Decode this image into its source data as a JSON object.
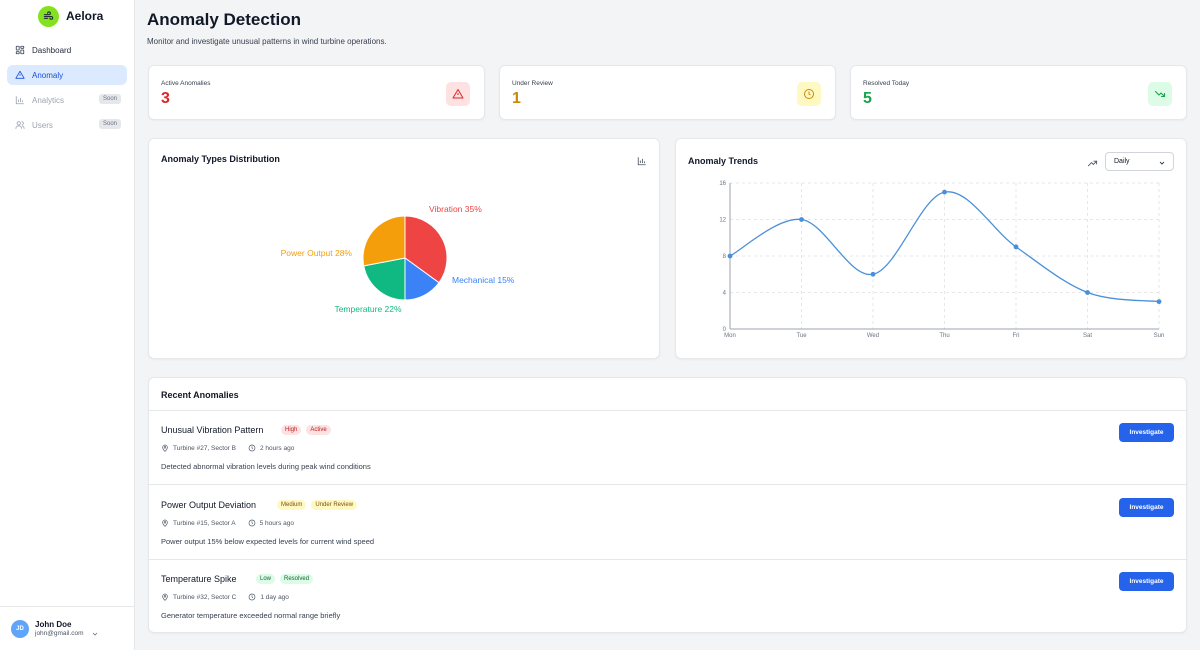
{
  "app": {
    "name": "Aelora"
  },
  "sidebar": {
    "items": [
      {
        "label": "Dashboard",
        "icon": "layout-grid-icon"
      },
      {
        "label": "Anomaly",
        "icon": "warning-triangle-icon"
      },
      {
        "label": "Analytics",
        "icon": "bar-chart-icon",
        "badge": "Soon"
      },
      {
        "label": "Users",
        "icon": "users-icon",
        "badge": "Soon"
      }
    ]
  },
  "user": {
    "initials": "JD",
    "name": "John Doe",
    "email": "john@gmail.com"
  },
  "page": {
    "title": "Anomaly Detection",
    "subtitle": "Monitor and investigate unusual patterns in wind turbine operations."
  },
  "stats": [
    {
      "label": "Active Anomalies",
      "value": "3",
      "color": "#dc2626",
      "icon": "warning-triangle-icon"
    },
    {
      "label": "Under Review",
      "value": "1",
      "color": "#ca8a04",
      "icon": "clock-icon"
    },
    {
      "label": "Resolved Today",
      "value": "5",
      "color": "#16a34a",
      "icon": "trending-down-icon"
    }
  ],
  "pie_card": {
    "title": "Anomaly Types Distribution"
  },
  "trend_card": {
    "title": "Anomaly Trends",
    "period": "Daily"
  },
  "chart_data": [
    {
      "type": "pie",
      "title": "Anomaly Types Distribution",
      "slices": [
        {
          "name": "Vibration",
          "value": 35,
          "label": "Vibration 35%",
          "color": "#ef4444"
        },
        {
          "name": "Mechanical",
          "value": 15,
          "label": "Mechanical 15%",
          "color": "#3b82f6"
        },
        {
          "name": "Temperature",
          "value": 22,
          "label": "Temperature 22%",
          "color": "#10b981"
        },
        {
          "name": "Power Output",
          "value": 28,
          "label": "Power Output 28%",
          "color": "#f59e0b"
        }
      ]
    },
    {
      "type": "line",
      "title": "Anomaly Trends",
      "categories": [
        "Mon",
        "Tue",
        "Wed",
        "Thu",
        "Fri",
        "Sat",
        "Sun"
      ],
      "series": [
        {
          "values": [
            8,
            12,
            6,
            15,
            9,
            4,
            3
          ],
          "color": "#4a90d9"
        }
      ],
      "ylim": [
        0,
        16
      ],
      "yticks": [
        0,
        4,
        8,
        12,
        16
      ],
      "grid": true
    }
  ],
  "recent": {
    "title": "Recent Anomalies",
    "button_label": "Investigate",
    "items": [
      {
        "title": "Unusual Vibration Pattern",
        "severity": "High",
        "status": "Active",
        "severity_colors": {
          "bg": "#fee2e2",
          "fg": "#b91c1c"
        },
        "status_colors": {
          "bg": "#fee2e2",
          "fg": "#b91c1c"
        },
        "location": "Turbine #27, Sector B",
        "time": "2 hours ago",
        "description": "Detected abnormal vibration levels during peak wind conditions"
      },
      {
        "title": "Power Output Deviation",
        "severity": "Medium",
        "status": "Under Review",
        "severity_colors": {
          "bg": "#fef9c3",
          "fg": "#854d0e"
        },
        "status_colors": {
          "bg": "#fef9c3",
          "fg": "#854d0e"
        },
        "location": "Turbine #15, Sector A",
        "time": "5 hours ago",
        "description": "Power output 15% below expected levels for current wind speed"
      },
      {
        "title": "Temperature Spike",
        "severity": "Low",
        "status": "Resolved",
        "severity_colors": {
          "bg": "#dcfce7",
          "fg": "#166534"
        },
        "status_colors": {
          "bg": "#dcfce7",
          "fg": "#166534"
        },
        "location": "Turbine #32, Sector C",
        "time": "1 day ago",
        "description": "Generator temperature exceeded normal range briefly"
      }
    ]
  }
}
